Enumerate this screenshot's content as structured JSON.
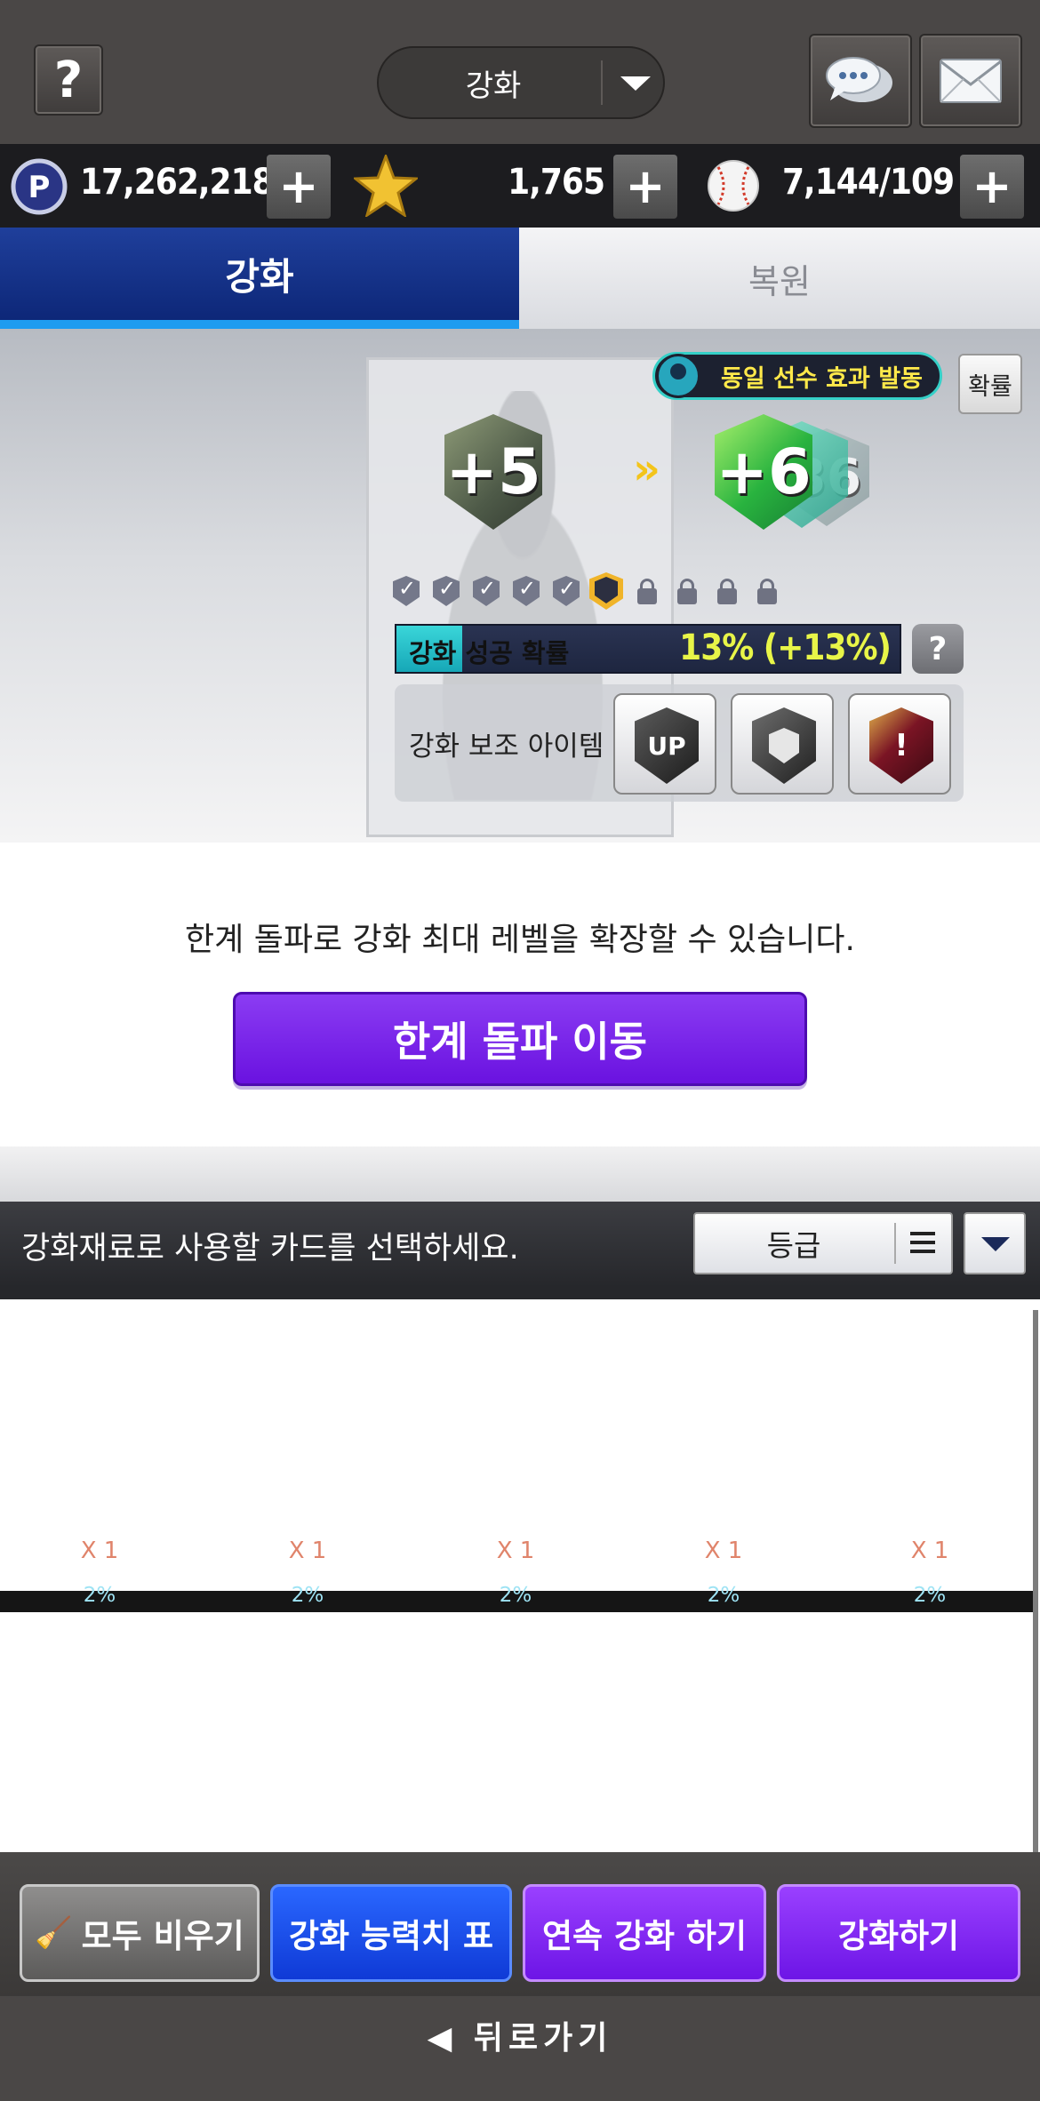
{
  "header": {
    "help_label": "?",
    "mode_title": "강화"
  },
  "currency": {
    "points": "17,262,218",
    "stars": "1,765",
    "balls": "7,144/109",
    "plus_label": "+"
  },
  "tabs": [
    {
      "label": "강화",
      "active": true
    },
    {
      "label": "복원",
      "active": false
    }
  ],
  "upgrade": {
    "same_player_badge": "동일 선수 효과 발동",
    "probability_button": "확률",
    "current_level": "+5",
    "next_level": "+6",
    "next_level_preview": "36",
    "progress_slots": {
      "completed": 5,
      "current": 1,
      "locked": 4
    },
    "success_rate_label": "강화 성공 확률",
    "success_rate_value": "13% (+13%)",
    "success_rate_percent": 13,
    "help_label": "?",
    "aux_items_label": "강화 보조 아이템",
    "aux_items": [
      {
        "icon": "up-arrow-shield-icon",
        "text": "UP"
      },
      {
        "icon": "guard-shield-icon",
        "text": ""
      },
      {
        "icon": "warning-shield-icon",
        "text": "!"
      }
    ]
  },
  "limit_break": {
    "description": "한계 돌파로 강화 최대 레벨을 확장할 수 있습니다.",
    "button_label": "한계 돌파 이동"
  },
  "materials": {
    "instruction": "강화재료로 사용할 카드를 선택하세요.",
    "sort_label": "등급",
    "cards": [
      {
        "count": "X 1",
        "rate": "2%"
      },
      {
        "count": "X 1",
        "rate": "2%"
      },
      {
        "count": "X 1",
        "rate": "2%"
      },
      {
        "count": "X 1",
        "rate": "2%"
      },
      {
        "count": "X 1",
        "rate": "2%"
      }
    ]
  },
  "actions": {
    "clear_all": "모두 비우기",
    "stats_table": "강화 능력치 표",
    "continuous_upgrade": "연속 강화 하기",
    "upgrade": "강화하기"
  },
  "footer": {
    "back_label": "◀ 뒤로가기"
  },
  "colors": {
    "active_tab": "#0d2778",
    "purple_button": "#6d15e6",
    "blue_button": "#0f3ad6",
    "rate_text": "#e8f548"
  }
}
